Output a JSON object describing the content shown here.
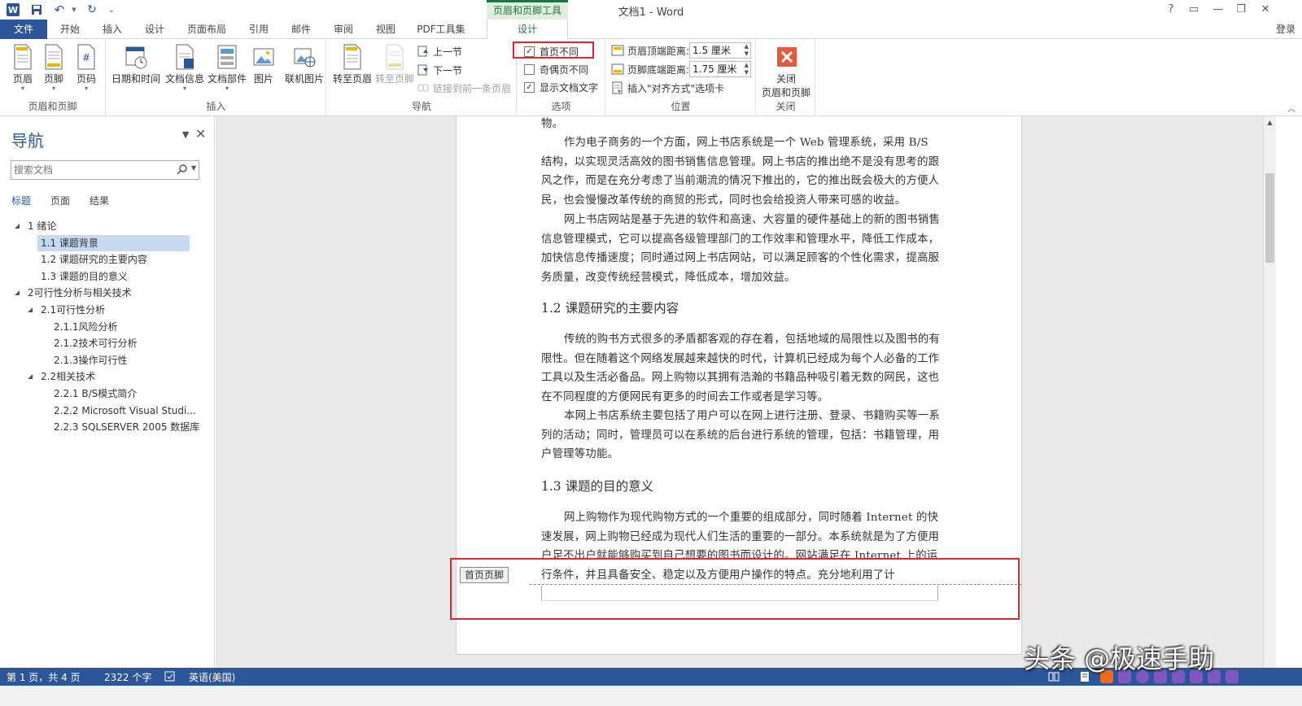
{
  "window": {
    "title": "文档1 - Word",
    "context_group": "页眉和页脚工具",
    "help": "?",
    "restore": "▭",
    "minimize": "—",
    "maximize": "❐",
    "close": "✕",
    "login": "登录"
  },
  "quick_access": {
    "undo": "↶",
    "redo": "↻",
    "customize": "⌄"
  },
  "tabs": [
    "文件",
    "开始",
    "插入",
    "设计",
    "页面布局",
    "引用",
    "邮件",
    "审阅",
    "视图",
    "PDF工具集",
    "设计"
  ],
  "ribbon": {
    "header_footer": {
      "label": "页眉和页脚",
      "buttons": [
        "页眉",
        "页脚",
        "页码"
      ]
    },
    "insert": {
      "label": "插入",
      "buttons": [
        "日期和时间",
        "文档信息",
        "文档部件",
        "图片",
        "联机图片"
      ]
    },
    "navigation": {
      "label": "导航",
      "goto_header": "转至页眉",
      "goto_footer": "转至页脚",
      "prev": "上一节",
      "next": "下一节",
      "link_prev": "链接到前一条页眉"
    },
    "options": {
      "label": "选项",
      "items": [
        {
          "label": "首页不同",
          "checked": "✓"
        },
        {
          "label": "奇偶页不同",
          "checked": ""
        },
        {
          "label": "显示文档文字",
          "checked": "✓"
        }
      ]
    },
    "position": {
      "label": "位置",
      "header_top_label": "页眉顶端距离:",
      "header_top_value": "1.5 厘米",
      "footer_bottom_label": "页脚底端距离:",
      "footer_bottom_value": "1.75 厘米",
      "align_tab": "插入\"对齐方式\"选项卡"
    },
    "close": {
      "label": "关闭",
      "button": "关闭\n页眉和页脚",
      "button_line1": "关闭",
      "button_line2": "页眉和页脚"
    },
    "collapse": "︿"
  },
  "nav": {
    "title": "导航",
    "search_placeholder": "搜索文档",
    "tabs": [
      "标题",
      "页面",
      "结果"
    ],
    "tree": [
      {
        "label": "1  绪论",
        "level": 0,
        "expander": "◢",
        "selected": false
      },
      {
        "label": "1.1 课题背景",
        "level": 1,
        "expander": "",
        "selected": true
      },
      {
        "label": "1.2 课题研究的主要内容",
        "level": 1,
        "expander": "",
        "selected": false
      },
      {
        "label": "1.3 课题的目的意义",
        "level": 1,
        "expander": "",
        "selected": false
      },
      {
        "label": "2可行性分析与相关技术",
        "level": 0,
        "expander": "◢",
        "selected": false
      },
      {
        "label": "2.1可行性分析",
        "level": 1,
        "expander": "◢",
        "selected": false
      },
      {
        "label": "2.1.1风险分析",
        "level": 2,
        "expander": "",
        "selected": false
      },
      {
        "label": "2.1.2技术可行分析",
        "level": 2,
        "expander": "",
        "selected": false
      },
      {
        "label": "2.1.3操作可行性",
        "level": 2,
        "expander": "",
        "selected": false
      },
      {
        "label": "2.2相关技术",
        "level": 1,
        "expander": "◢",
        "selected": false
      },
      {
        "label": "2.2.1 B/S模式简介",
        "level": 2,
        "expander": "",
        "selected": false
      },
      {
        "label": "2.2.2 Microsoft Visual Studi...",
        "level": 2,
        "expander": "",
        "selected": false
      },
      {
        "label": "2.2.3 SQLSERVER 2005 数据库",
        "level": 2,
        "expander": "",
        "selected": false
      }
    ]
  },
  "document": {
    "lines_top": "物。",
    "p1": "作为电子商务的一个方面，网上书店系统是一个 Web 管理系统，采用 B/S 结构，以实现灵活高效的图书销售信息管理。网上书店的推出绝不是没有思考的跟风之作，而是在充分考虑了当前潮流的情况下推出的，它的推出既会极大的方便人民，也会慢慢改革传统的商贸的形式，同时也会给投资人带来可感的收益。",
    "p2": "网上书店网站是基于先进的软件和高速、大容量的硬件基础上的新的图书销售信息管理模式，它可以提高各级管理部门的工作效率和管理水平，降低工作成本，加快信息传播速度；同时通过网上书店网站，可以满足顾客的个性化需求，提高服务质量，改变传统经营模式，降低成本，增加效益。",
    "h12": "1.2  课题研究的主要内容",
    "p3": "传统的购书方式很多的矛盾都客观的存在着，包括地域的局限性以及图书的有限性。但在随着这个网络发展越来越快的时代，计算机已经成为每个人必备的工作工具以及生活必备品。网上购物以其拥有浩瀚的书籍品种吸引着无数的网民，这也在不同程度的方便网民有更多的时间去工作或者是学习等。",
    "p4": "本网上书店系统主要包括了用户可以在网上进行注册、登录、书籍购买等一系列的活动；同时，管理员可以在系统的后台进行系统的管理，包括：书籍管理，用户管理等功能。",
    "h13": "1.3  课题的目的意义",
    "p5": "网上购物作为现代购物方式的一个重要的组成部分，同时随着 Internet 的快速发展，网上购物已经成为现代人们生活的重要的一部分。本系统就是为了方便用户足不出户就能够购买到自己想要的图书而设计的。网站满足在 Internet 上的运行条件，并且具备安全、稳定以及方便用户操作的特点。充分地利用了计",
    "footer_tag": "首页页脚"
  },
  "statusbar": {
    "page": "第 1 页，共 4 页",
    "words": "2322 个字",
    "lang": "英语(美国)"
  },
  "watermark": "头条 @极速手助",
  "colors": {
    "word_blue": "#2b579a",
    "context_green": "#217346",
    "highlight_red": "#e0262e",
    "selection": "#c5d9f1"
  }
}
